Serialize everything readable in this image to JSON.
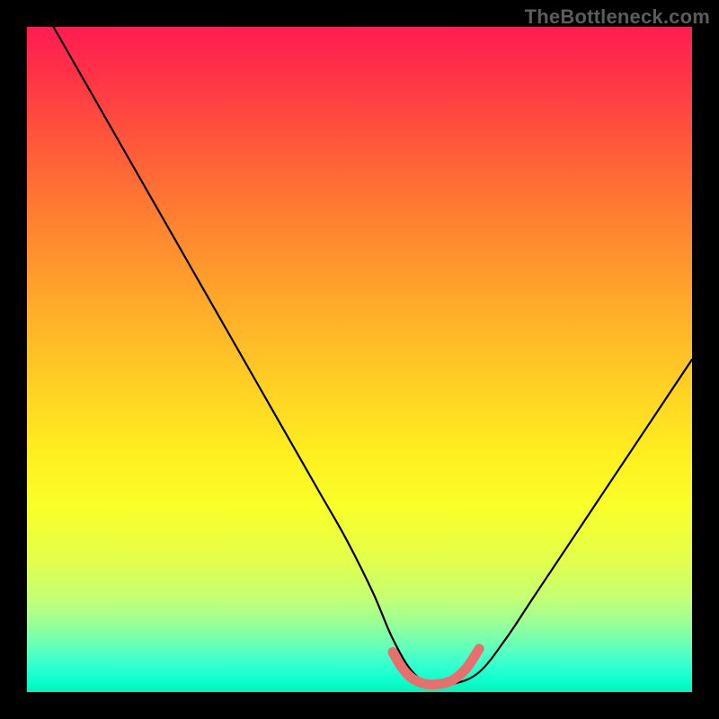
{
  "watermark": "TheBottleneck.com",
  "colors": {
    "black": "#000000",
    "highlight": "#e86f6d"
  },
  "chart_data": {
    "type": "line",
    "title": "",
    "xlabel": "",
    "ylabel": "",
    "xlim": [
      0,
      100
    ],
    "ylim": [
      0,
      100
    ],
    "series": [
      {
        "name": "bottleneck-curve",
        "x": [
          4,
          8,
          12,
          16,
          20,
          24,
          28,
          32,
          36,
          40,
          44,
          48,
          52,
          55,
          58,
          61,
          64,
          68,
          72,
          76,
          80,
          84,
          88,
          92,
          96,
          100
        ],
        "y": [
          100,
          93,
          86,
          79,
          72,
          65,
          58,
          51,
          44,
          37,
          30,
          23,
          15,
          8,
          3,
          1.2,
          1.2,
          3,
          8,
          14,
          20,
          26,
          32,
          38,
          44,
          50
        ]
      },
      {
        "name": "highlight-minimum",
        "x": [
          55,
          56.5,
          58,
          60,
          62,
          64,
          66,
          68
        ],
        "y": [
          6,
          3.5,
          2,
          1.2,
          1.2,
          1.8,
          3.5,
          6.5
        ]
      }
    ],
    "annotations": []
  }
}
